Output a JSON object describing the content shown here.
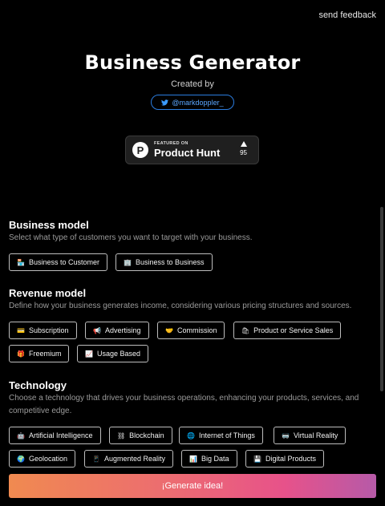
{
  "header": {
    "feedback": "send feedback",
    "title": "Business Generator",
    "created_by": "Created by",
    "twitter_handle": "@markdoppler_"
  },
  "product_hunt": {
    "featured": "FEATURED ON",
    "name": "Product Hunt",
    "logo_letter": "P",
    "votes": "95"
  },
  "business_model": {
    "heading": "Business model",
    "description": "Select what type of customers you want to target with your business.",
    "options": [
      {
        "label": "Business to Customer",
        "icon": "🏪"
      },
      {
        "label": "Business to Business",
        "icon": "🏢"
      }
    ]
  },
  "revenue_model": {
    "heading": "Revenue model",
    "description": "Define how your business generates income, considering various pricing structures and sources.",
    "options": [
      {
        "label": "Subscription",
        "icon": "💳"
      },
      {
        "label": "Advertising",
        "icon": "📢"
      },
      {
        "label": "Commission",
        "icon": "🤝"
      },
      {
        "label": "Product or Service Sales",
        "icon": "🛍"
      },
      {
        "label": "Freemium",
        "icon": "🎁"
      },
      {
        "label": "Usage Based",
        "icon": "📈"
      }
    ]
  },
  "technology": {
    "heading": "Technology",
    "description": "Choose a technology that drives your business operations, enhancing your products, services, and competitive edge.",
    "options": [
      {
        "label": "Artificial Intelligence",
        "icon": "🤖"
      },
      {
        "label": "Blockchain",
        "icon": "⛓"
      },
      {
        "label": "Internet of Things",
        "icon": "🌐"
      },
      {
        "label": "Virtual Reality",
        "icon": "🥽"
      },
      {
        "label": "Geolocation",
        "icon": "🌍"
      },
      {
        "label": "Augmented Reality",
        "icon": "📱"
      },
      {
        "label": "Big Data",
        "icon": "📊"
      },
      {
        "label": "Digital Products",
        "icon": "💾"
      }
    ]
  },
  "generate_button": "¡Generate idea!",
  "colors": {
    "accent": "#e7528a",
    "twitter": "#2b7de0"
  }
}
